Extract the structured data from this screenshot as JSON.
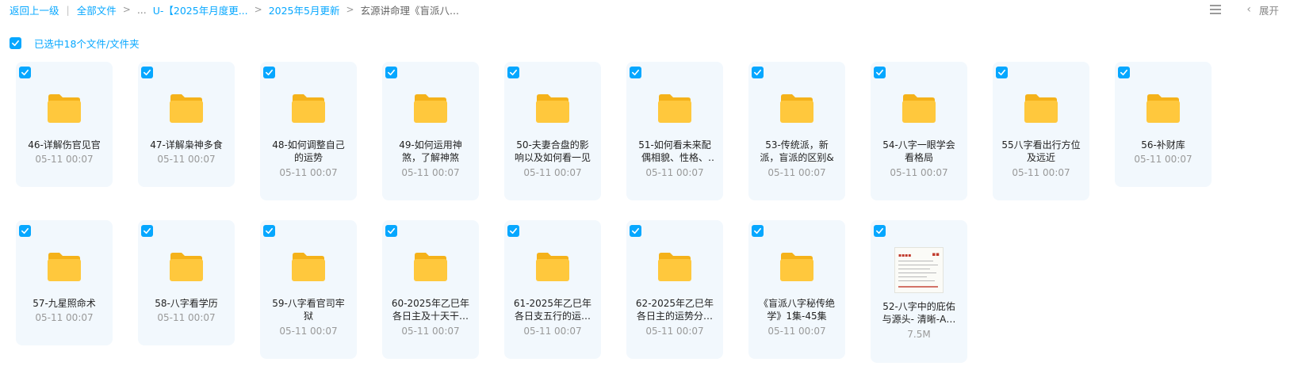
{
  "breadcrumb": {
    "back": "返回上一级",
    "root": "全部文件",
    "ellipsis": "...",
    "level1": "U-【2025年月度更...",
    "level2": "2025年5月更新",
    "current": "玄源讲命理《盲派八..."
  },
  "header_right": {
    "expand": "展开"
  },
  "selection": {
    "text": "已选中18个文件/文件夹"
  },
  "colors": {
    "accent": "#06a7ff",
    "card_bg": "#f2f8fd",
    "folder": "#ffc83d"
  },
  "files": [
    {
      "name": "46-详解伤官见官",
      "meta": "05-11 00:07",
      "icon": "folder-icon"
    },
    {
      "name": "47-详解枭神多食",
      "meta": "05-11 00:07",
      "icon": "folder-icon"
    },
    {
      "name": "48-如何调整自己的运势",
      "meta": "05-11 00:07",
      "icon": "folder-icon"
    },
    {
      "name": "49-如何运用神煞，了解神煞",
      "meta": "05-11 00:07",
      "icon": "folder-icon"
    },
    {
      "name": "50-夫妻合盘的影响以及如何看一见",
      "meta": "05-11 00:07",
      "icon": "folder-icon"
    },
    {
      "name": "51-如何看未来配偶相貌、性格、大…",
      "meta": "05-11 00:07",
      "icon": "folder-icon"
    },
    {
      "name": "53-传统派，新派，盲派的区别&",
      "meta": "05-11 00:07",
      "icon": "folder-icon"
    },
    {
      "name": "54-八字一眼学会看格局",
      "meta": "05-11 00:07",
      "icon": "folder-icon"
    },
    {
      "name": "55八字看出行方位及远近",
      "meta": "05-11 00:07",
      "icon": "folder-icon"
    },
    {
      "name": "56-补财库",
      "meta": "05-11 00:07",
      "icon": "folder-icon"
    },
    {
      "name": "57-九星照命术",
      "meta": "05-11 00:07",
      "icon": "folder-icon"
    },
    {
      "name": "58-八字看学历",
      "meta": "05-11 00:07",
      "icon": "folder-icon"
    },
    {
      "name": "59-八字看官司牢狱",
      "meta": "05-11 00:07",
      "icon": "folder-icon"
    },
    {
      "name": "60-2025年乙巳年各日主及十天干…",
      "meta": "05-11 00:07",
      "icon": "folder-icon"
    },
    {
      "name": "61-2025年乙巳年各日支五行的运…",
      "meta": "05-11 00:07",
      "icon": "folder-icon"
    },
    {
      "name": "62-2025年乙巳年各日主的运势分…",
      "meta": "05-11 00:07",
      "icon": "folder-icon"
    },
    {
      "name": "《盲派八字秘传绝学》1集-45集",
      "meta": "05-11 00:07",
      "icon": "folder-icon"
    },
    {
      "name": "52-八字中的庇佑与源头- 清晰-A…",
      "meta": "7.5M",
      "icon": "document-thumbnail"
    }
  ]
}
